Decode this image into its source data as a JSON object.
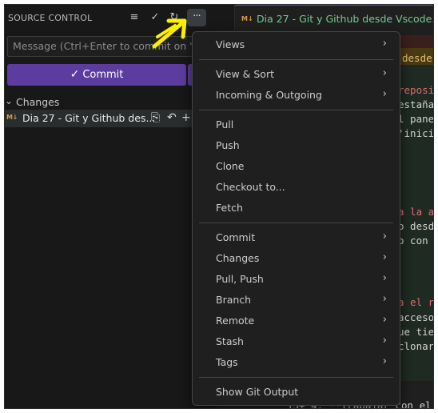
{
  "sidebar": {
    "title": "SOURCE CONTROL",
    "header_icons": [
      "view-as-list-icon",
      "commit-check-icon",
      "refresh-icon"
    ],
    "more_actions_label": "···",
    "message_placeholder": "Message (Ctrl+Enter to commit on 'm",
    "commit_label": "Commit",
    "changes_label": "Changes",
    "file": {
      "badge": "M↓",
      "name": "Dia 27 - Git y Github des..."
    }
  },
  "editor": {
    "tab_badge": "M↓",
    "tab_title": "Dia 27 - Git y Github desde Vscode.md",
    "lines": [
      {
        "text": "desde",
        "color": "#e5c07b"
      },
      {
        "text": "reposi",
        "color": "#e06c75"
      },
      {
        "text": "estaña",
        "color": "#d4d4d4"
      },
      {
        "text": "l panel",
        "color": "#d4d4d4"
      },
      {
        "text": "'inicia",
        "color": "#d4d4d4"
      },
      {
        "text": "a la ap",
        "color": "#e06c75"
      },
      {
        "text": "o desde",
        "color": "#d4d4d4"
      },
      {
        "text": "o con v",
        "color": "#d4d4d4"
      },
      {
        "text": "a el re",
        "color": "#e06c75"
      },
      {
        "text": "acceso,",
        "color": "#d4d4d4"
      },
      {
        "text": "ue tien",
        "color": "#d4d4d4"
      },
      {
        "text": " clonar",
        "color": "#d4d4d4"
      },
      {
        "text": "15+ 4. **Trabajar con el",
        "color": "#d4d4d4"
      }
    ]
  },
  "menu": {
    "items": [
      {
        "label": "Views",
        "submenu": true
      },
      {
        "label": "View & Sort",
        "submenu": true
      },
      {
        "label": "Incoming & Outgoing",
        "submenu": true
      },
      {
        "label": "Pull",
        "submenu": false
      },
      {
        "label": "Push",
        "submenu": false
      },
      {
        "label": "Clone",
        "submenu": false
      },
      {
        "label": "Checkout to...",
        "submenu": false
      },
      {
        "label": "Fetch",
        "submenu": false
      },
      {
        "label": "Commit",
        "submenu": true
      },
      {
        "label": "Changes",
        "submenu": true
      },
      {
        "label": "Pull, Push",
        "submenu": true
      },
      {
        "label": "Branch",
        "submenu": true
      },
      {
        "label": "Remote",
        "submenu": true
      },
      {
        "label": "Stash",
        "submenu": true
      },
      {
        "label": "Tags",
        "submenu": true
      },
      {
        "label": "Show Git Output",
        "submenu": false
      }
    ],
    "arrow_glyph": "›"
  },
  "colors": {
    "commit_button": "#5c3c9e",
    "annotation_arrow": "#ffee00",
    "menu_bg": "#1f1f1f"
  }
}
